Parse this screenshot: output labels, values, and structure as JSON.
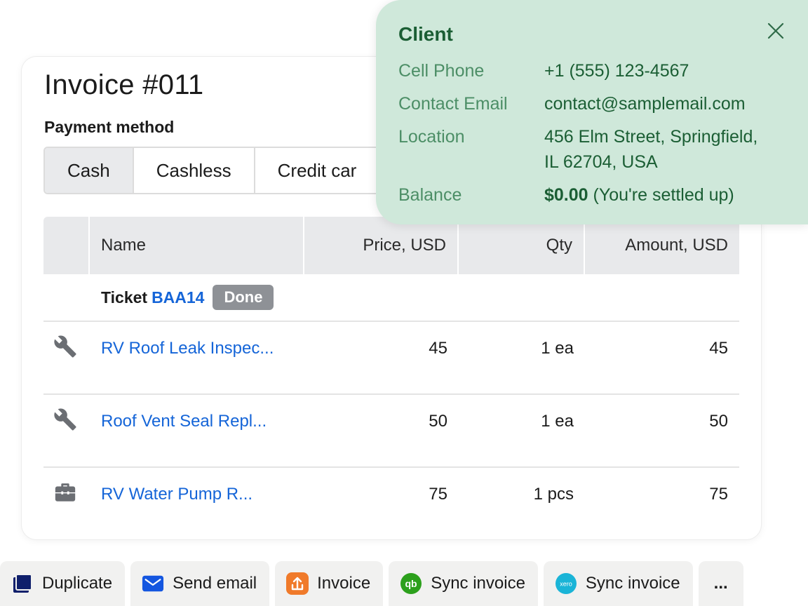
{
  "invoice": {
    "title": "Invoice #011",
    "payment_method_label": "Payment method",
    "payment_options": [
      "Cash",
      "Cashless",
      "Credit car"
    ],
    "selected_payment": "Cash"
  },
  "table": {
    "headers": {
      "name": "Name",
      "price": "Price, USD",
      "qty": "Qty",
      "amount": "Amount, USD"
    },
    "ticket": {
      "word": "Ticket",
      "id": "BAA14",
      "status": "Done"
    },
    "rows": [
      {
        "icon": "wrench-icon",
        "name": "RV Roof Leak Inspec...",
        "price": "45",
        "qty": "1 ea",
        "amount": "45"
      },
      {
        "icon": "wrench-icon",
        "name": "Roof Vent Seal Repl...",
        "price": "50",
        "qty": "1 ea",
        "amount": "50"
      },
      {
        "icon": "toolbox-icon",
        "name": "RV Water Pump R...",
        "price": "75",
        "qty": "1 pcs",
        "amount": "75"
      }
    ]
  },
  "client_popover": {
    "title": "Client",
    "cell_phone_label": "Cell Phone",
    "cell_phone": "+1 (555) 123-4567",
    "email_label": "Contact Email",
    "email": "contact@samplemail.com",
    "location_label": "Location",
    "location_line1": "456 Elm Street, Springfield,",
    "location_line2": "IL 62704, USA",
    "balance_label": "Balance",
    "balance_amount": "$0.00",
    "balance_note": " (You're settled up)"
  },
  "actions": [
    {
      "label": "Duplicate",
      "icon": "duplicate-icon"
    },
    {
      "label": "Send email",
      "icon": "email-icon"
    },
    {
      "label": "Invoice",
      "icon": "upload-icon"
    },
    {
      "label": "Sync invoice",
      "icon": "quickbooks-icon"
    },
    {
      "label": "Sync invoice",
      "icon": "xero-icon"
    },
    {
      "label": "...",
      "icon": "more-icon"
    }
  ],
  "colors": {
    "link": "#1565d8",
    "popover_bg": "#cfe8da",
    "popover_text": "#1b5e34",
    "badge_bg": "#8e9196"
  }
}
